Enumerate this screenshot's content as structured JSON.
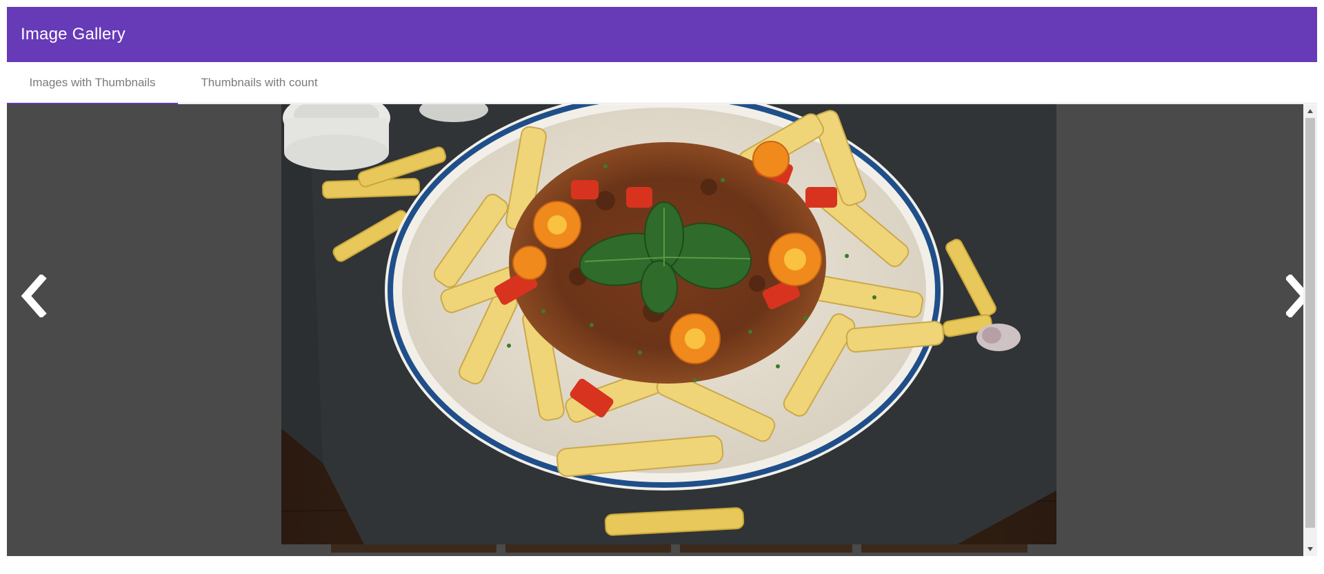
{
  "app": {
    "title": "Image Gallery",
    "accent_color": "#673ab7"
  },
  "tabs": [
    {
      "label": "Images with Thumbnails",
      "active": true
    },
    {
      "label": "Thumbnails with count",
      "active": false
    }
  ],
  "gallery": {
    "background_color": "#4a4a4a",
    "main_image": {
      "subject": "pasta-bolognese-photo"
    },
    "prev_icon": "chevron-left-icon",
    "next_icon": "chevron-right-icon",
    "thumbnail_count_visible": 4
  },
  "scrollbar": {
    "up_icon": "scroll-up-arrow-icon",
    "down_icon": "scroll-down-arrow-icon"
  }
}
